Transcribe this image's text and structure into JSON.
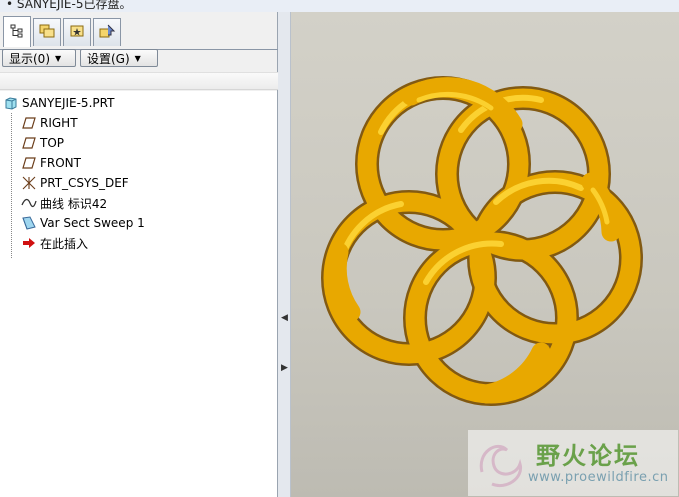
{
  "message_bar": {
    "text": "• SANYEJIE-5已存盘。"
  },
  "navigator": {
    "tabs": [
      {
        "icon": "model-tree-icon"
      },
      {
        "icon": "folder-browser-icon"
      },
      {
        "icon": "favorites-icon"
      },
      {
        "icon": "connections-icon"
      }
    ],
    "show_label": "显示(0)",
    "settings_label": "设置(G)"
  },
  "model_tree": {
    "root": "SANYEJIE-5.PRT",
    "items": [
      {
        "label": "RIGHT",
        "icon": "datum-plane-icon"
      },
      {
        "label": "TOP",
        "icon": "datum-plane-icon"
      },
      {
        "label": "FRONT",
        "icon": "datum-plane-icon"
      },
      {
        "label": "PRT_CSYS_DEF",
        "icon": "csys-icon"
      },
      {
        "label": "曲线 标识42",
        "icon": "curve-icon"
      },
      {
        "label": "Var Sect Sweep 1",
        "icon": "sweep-icon"
      },
      {
        "label": "在此插入",
        "icon": "insert-here-arrow-icon"
      }
    ]
  },
  "watermark": {
    "title": "野火论坛",
    "url": "www.proewildfire.cn"
  },
  "colors": {
    "knot_gold": "#e8a800",
    "knot_shadow": "#8a5a00",
    "viewport_bg": "#cfcdc4"
  }
}
